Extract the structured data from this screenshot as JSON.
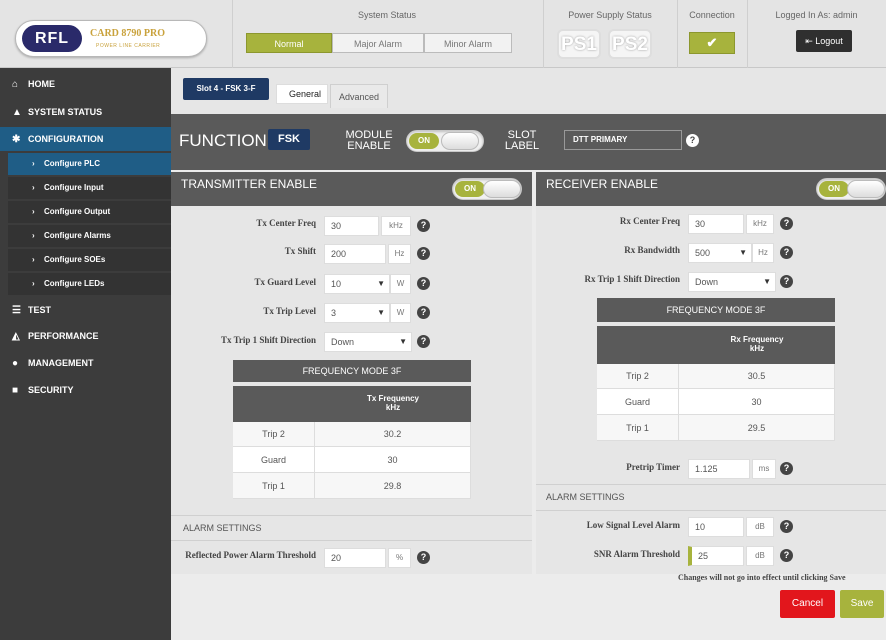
{
  "header": {
    "logo_abbr": "RFL",
    "logo_name": "CARD 8790 PRO",
    "logo_sub": "POWER LINE CARRIER",
    "system_status_title": "System Status",
    "status_normal": "Normal",
    "status_major": "Major Alarm",
    "status_minor": "Minor Alarm",
    "power_supply_title": "Power Supply Status",
    "ps1": "PS1",
    "ps2": "PS2",
    "connection_title": "Connection",
    "connection_icon": "✔",
    "logged_in": "Logged In As: admin",
    "logout": "Logout"
  },
  "sidebar": {
    "home": "HOME",
    "system_status": "SYSTEM STATUS",
    "configuration": "CONFIGURATION",
    "sub": [
      "Configure PLC",
      "Configure Input",
      "Configure Output",
      "Configure Alarms",
      "Configure SOEs",
      "Configure LEDs"
    ],
    "test": "TEST",
    "performance": "PERFORMANCE",
    "management": "MANAGEMENT",
    "security": "SECURITY"
  },
  "tabs": {
    "slot": "Slot 4 - FSK 3-F",
    "general": "General",
    "advanced": "Advanced"
  },
  "function_bar": {
    "function_label": "FUNCTION -",
    "function_value": "FSK",
    "module_enable_1": "MODULE",
    "module_enable_2": "ENABLE",
    "toggle_on": "ON",
    "slot_label_1": "SLOT",
    "slot_label_2": "LABEL",
    "slot_label_value": "DTT PRIMARY"
  },
  "tx": {
    "title": "TRANSMITTER ENABLE",
    "toggle": "ON",
    "center_freq_label": "Tx Center Freq",
    "center_freq_value": "30",
    "center_freq_unit": "kHz",
    "shift_label": "Tx Shift",
    "shift_value": "200",
    "shift_unit": "Hz",
    "guard_label": "Tx Guard Level",
    "guard_value": "10",
    "guard_unit": "W",
    "trip_label": "Tx Trip Level",
    "trip_value": "3",
    "trip_unit": "W",
    "dir_label": "Tx Trip 1 Shift Direction",
    "dir_value": "Down",
    "freq_mode_title": "FREQUENCY MODE 3F",
    "freq_header_1": "Tx Frequency",
    "freq_header_2": "kHz",
    "rows": [
      [
        "Trip 2",
        "30.2"
      ],
      [
        "Guard",
        "30"
      ],
      [
        "Trip 1",
        "29.8"
      ]
    ],
    "alarm_settings": "ALARM SETTINGS",
    "reflected_label": "Reflected Power Alarm Threshold",
    "reflected_value": "20",
    "reflected_unit": "%"
  },
  "rx": {
    "title": "RECEIVER ENABLE",
    "toggle": "ON",
    "center_freq_label": "Rx Center Freq",
    "center_freq_value": "30",
    "center_freq_unit": "kHz",
    "bandwidth_label": "Rx Bandwidth",
    "bandwidth_value": "500",
    "bandwidth_unit": "Hz",
    "dir_label": "Rx Trip 1 Shift Direction",
    "dir_value": "Down",
    "freq_mode_title": "FREQUENCY MODE 3F",
    "freq_header_1": "Rx Frequency",
    "freq_header_2": "kHz",
    "rows": [
      [
        "Trip 2",
        "30.5"
      ],
      [
        "Guard",
        "30"
      ],
      [
        "Trip 1",
        "29.5"
      ]
    ],
    "pretrip_label": "Pretrip Timer",
    "pretrip_value": "1.125",
    "pretrip_unit": "ms",
    "alarm_settings": "ALARM SETTINGS",
    "low_signal_label": "Low Signal Level Alarm",
    "low_signal_value": "10",
    "low_signal_unit": "dB",
    "snr_label": "SNR Alarm Threshold",
    "snr_value": "25",
    "snr_unit": "dB"
  },
  "footer": {
    "note": "Changes will not go into effect until clicking Save",
    "cancel": "Cancel",
    "save": "Save"
  },
  "colors": {
    "accent_green": "#a7b33d",
    "nav_active": "#1f5d86",
    "navy": "#1f3a64",
    "cancel_red": "#e2161c"
  }
}
